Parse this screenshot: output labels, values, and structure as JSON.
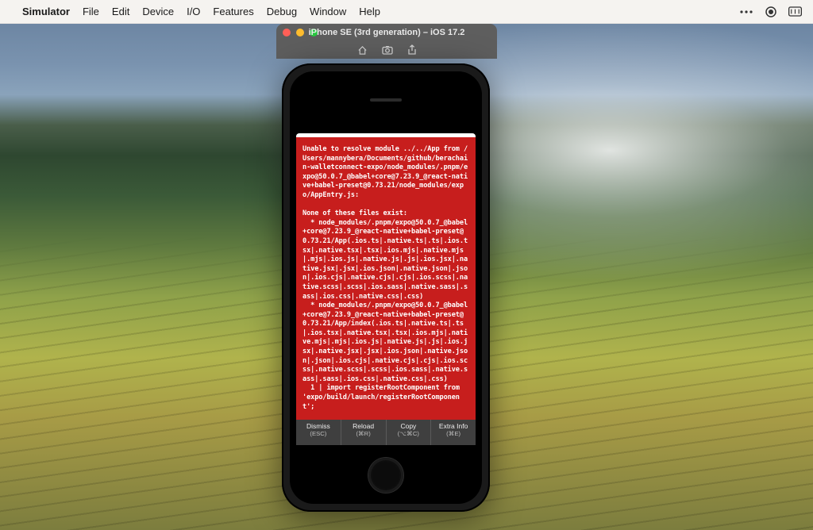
{
  "menubar": {
    "app_name": "Simulator",
    "items": [
      "File",
      "Edit",
      "Device",
      "I/O",
      "Features",
      "Debug",
      "Window",
      "Help"
    ]
  },
  "sim_window": {
    "title": "iPhone SE (3rd generation) – iOS 17.2",
    "toolbar_icons": [
      "home-icon",
      "screenshot-icon",
      "share-icon"
    ]
  },
  "error_screen": {
    "text": "Unable to resolve module ../../App from /Users/mannybera/Documents/github/berachain-walletconnect-expo/node_modules/.pnpm/expo@50.0.7_@babel+core@7.23.9_@react-native+babel-preset@0.73.21/node_modules/expo/AppEntry.js:\n\nNone of these files exist:\n  * node_modules/.pnpm/expo@50.0.7_@babel+core@7.23.9_@react-native+babel-preset@0.73.21/App(.ios.ts|.native.ts|.ts|.ios.tsx|.native.tsx|.tsx|.ios.mjs|.native.mjs|.mjs|.ios.js|.native.js|.js|.ios.jsx|.native.jsx|.jsx|.ios.json|.native.json|.json|.ios.cjs|.native.cjs|.cjs|.ios.scss|.native.scss|.scss|.ios.sass|.native.sass|.sass|.ios.css|.native.css|.css)\n  * node_modules/.pnpm/expo@50.0.7_@babel+core@7.23.9_@react-native+babel-preset@0.73.21/App/index(.ios.ts|.native.ts|.ts|.ios.tsx|.native.tsx|.tsx|.ios.mjs|.native.mjs|.mjs|.ios.js|.native.js|.js|.ios.jsx|.native.jsx|.jsx|.ios.json|.native.json|.json|.ios.cjs|.native.cjs|.cjs|.ios.scss|.native.scss|.scss|.ios.sass|.native.sass|.sass|.ios.css|.native.css|.css)\n  1 | import registerRootComponent from 'expo/build/launch/registerRootComponent';",
    "actions": [
      {
        "label": "Dismiss",
        "shortcut": "(ESC)"
      },
      {
        "label": "Reload",
        "shortcut": "(⌘R)"
      },
      {
        "label": "Copy",
        "shortcut": "(⌥⌘C)"
      },
      {
        "label": "Extra Info",
        "shortcut": "(⌘E)"
      }
    ]
  },
  "colors": {
    "error_bg": "#c71e1d"
  }
}
